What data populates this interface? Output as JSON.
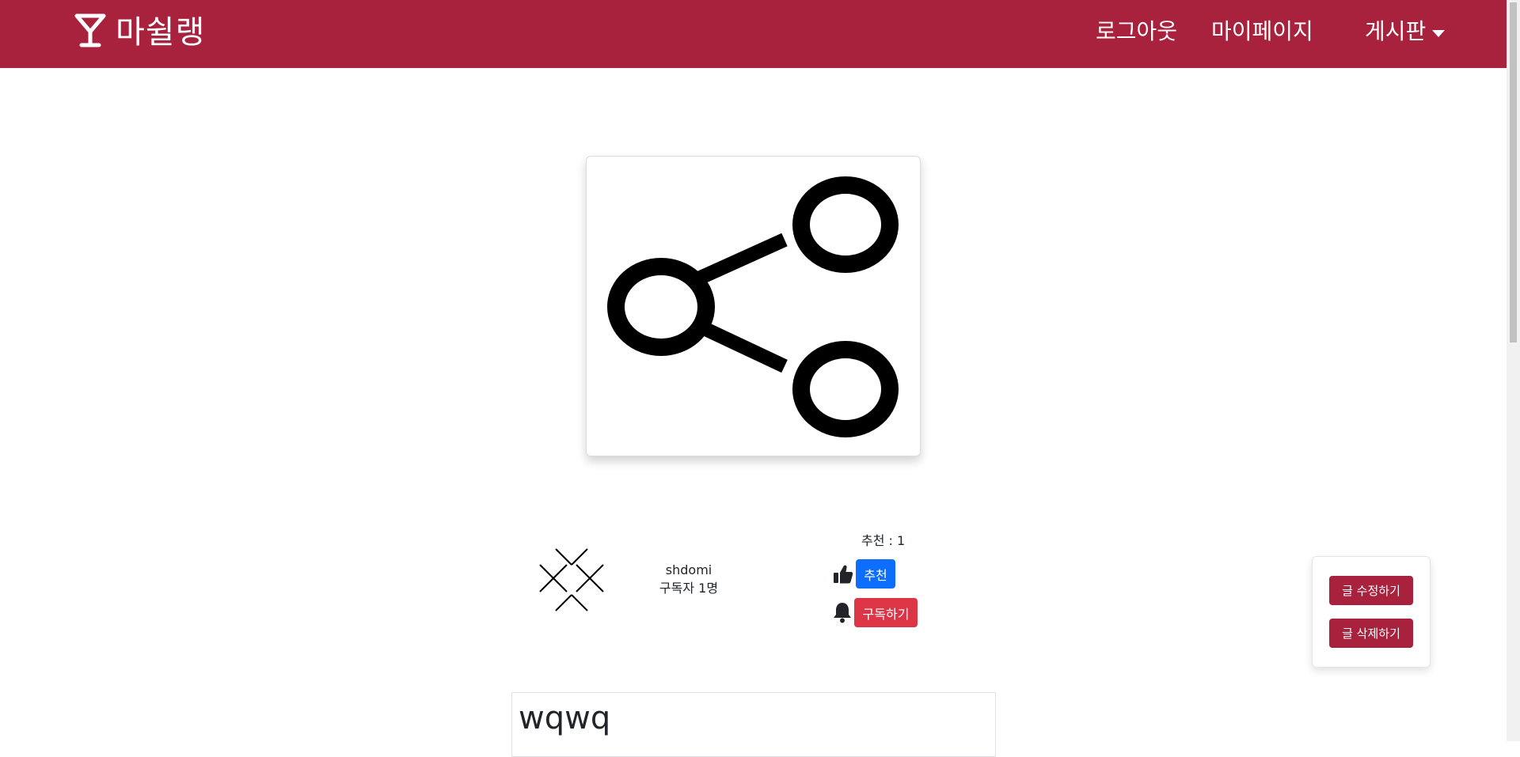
{
  "navbar": {
    "brand_icon": "cocktail-glass-icon",
    "brand_text": "마쉴랭",
    "links": {
      "logout": "로그아웃",
      "mypage": "마이페이지",
      "board": "게시판"
    },
    "background_color": "#a8223e"
  },
  "post": {
    "image_icon": "share-icon",
    "title": "wqwq"
  },
  "author": {
    "avatar_icon": "broken-image-x-icon",
    "name": "shdomi",
    "subscribers": "구독자 1명"
  },
  "actions": {
    "recommend_count": "추천 : 1",
    "recommend_label": "추천",
    "subscribe_label": "구독하기",
    "recommend_color": "#0d6efd",
    "subscribe_color": "#dc3545"
  },
  "side_panel": {
    "edit_label": "글 수정하기",
    "delete_label": "글 삭제하기"
  }
}
